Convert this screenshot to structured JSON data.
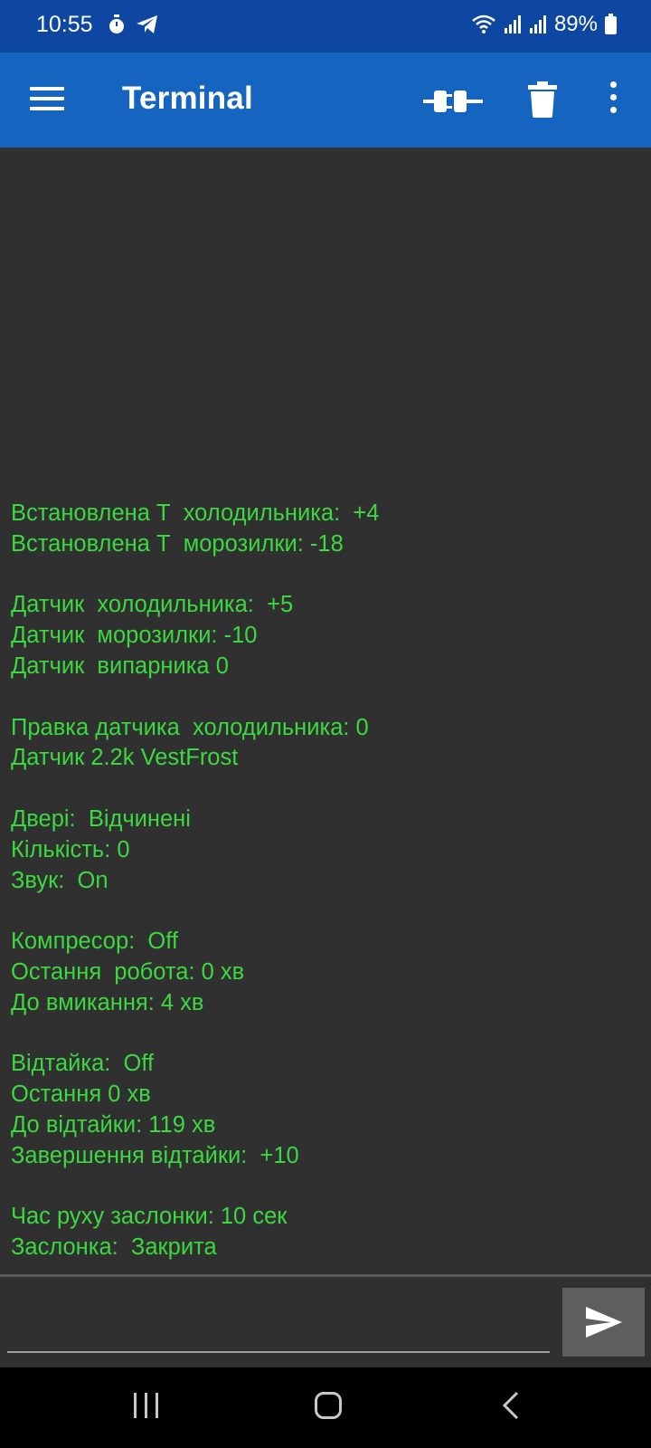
{
  "status_bar": {
    "time": "10:55",
    "battery": "89%",
    "left_icons": [
      "stopwatch-icon",
      "telegram-icon"
    ],
    "right_icons": [
      "wifi-icon",
      "signal-icon",
      "signal-icon",
      "battery-icon"
    ]
  },
  "app_bar": {
    "title": "Terminal",
    "actions": [
      "connect-icon",
      "delete-icon",
      "more-vert-icon"
    ]
  },
  "terminal": {
    "lines": [
      "Встановлена Т  холодильника:  +4",
      "Встановлена Т  морозилки: -18",
      "",
      "Датчик  холодильника:  +5",
      "Датчик  морозилки: -10",
      "Датчик  випарника 0",
      "",
      "Правка датчика  холодильника: 0",
      "Датчик 2.2k VestFrost",
      "",
      "Двері:  Відчинені",
      "Кількість: 0",
      "Звук:  On",
      "",
      "Компресор:  Off",
      "Остання  робота: 0 хв",
      "До вмикання: 4 хв",
      "",
      "Відтайка:  Off",
      "Остання 0 хв",
      "До відтайки: 119 хв",
      "Завершення відтайки:  +10",
      "",
      "Час руху заслонки: 10 сек",
      "Заслонка:  Закрита"
    ],
    "text_color": "#3bd93f",
    "background": "#303030"
  },
  "input": {
    "value": "",
    "placeholder": ""
  },
  "colors": {
    "status_bar": "#0d47a1",
    "app_bar": "#1565c0",
    "send_button": "#5e5e5e"
  }
}
